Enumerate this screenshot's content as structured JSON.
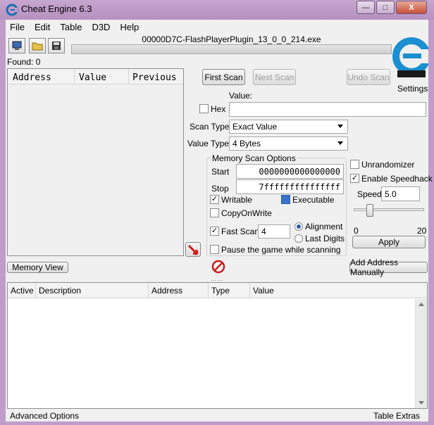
{
  "window": {
    "title": "Cheat Engine 6.3",
    "minimize": "—",
    "maximize": "□",
    "close": "X"
  },
  "menu": [
    "File",
    "Edit",
    "Table",
    "D3D",
    "Help"
  ],
  "process_name": "00000D7C-FlashPlayerPlugin_13_0_0_214.exe",
  "found": "Found: 0",
  "settings_label": "Settings",
  "results_columns": {
    "address": "Address",
    "value": "Value",
    "previous": "Previous"
  },
  "scan": {
    "first_scan": "First Scan",
    "next_scan": "Next Scan",
    "undo_scan": "Undo Scan",
    "value_label": "Value:",
    "hex_label": "Hex",
    "value_input": "",
    "scan_type_label": "Scan Type",
    "scan_type": "Exact Value",
    "value_type_label": "Value Type",
    "value_type": "4 Bytes"
  },
  "memory_options": {
    "title": "Memory Scan Options",
    "start_label": "Start",
    "start_value": "0000000000000000",
    "stop_label": "Stop",
    "stop_value": "7fffffffffffffff",
    "writable": "Writable",
    "executable": "Executable",
    "copyonwrite": "CopyOnWrite",
    "fast_scan": "Fast Scan",
    "fast_scan_value": "4",
    "alignment": "Alignment",
    "last_digits": "Last Digits",
    "pause": "Pause the game while scanning"
  },
  "speedhack": {
    "unrandomizer": "Unrandomizer",
    "enable": "Enable Speedhack",
    "speed_label": "Speed",
    "speed_value": "5.0",
    "slider_min": "0",
    "slider_max": "20",
    "slider_level": 0.2,
    "apply": "Apply"
  },
  "memory_view": "Memory View",
  "add_address": "Add Address Manually",
  "table_columns": {
    "active": "Active",
    "description": "Description",
    "address": "Address",
    "type": "Type",
    "value": "Value"
  },
  "footer": {
    "advanced": "Advanced Options",
    "extras": "Table Extras"
  },
  "colors": {
    "title_bar": "#b691c0",
    "accent": "#2a5fa8",
    "logo": "#1b8fd0"
  }
}
